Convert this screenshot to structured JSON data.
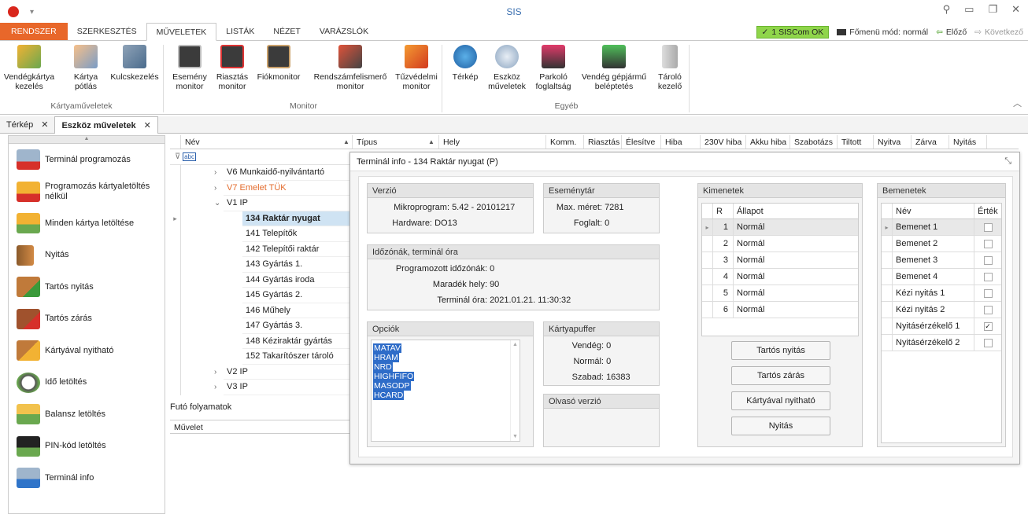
{
  "window": {
    "title": "SIS"
  },
  "ribbon_tabs": [
    "RENDSZER",
    "SZERKESZTÉS",
    "MŰVELETEK",
    "LISTÁK",
    "NÉZET",
    "VARÁZSLÓK"
  ],
  "ribbon_right": {
    "siscom": "1 SISCom OK",
    "mode": "Főmenü mód: normál",
    "prev": "Előző",
    "next": "Következő"
  },
  "groups": {
    "kartya": {
      "label": "Kártyaműveletek",
      "b1": "Vendégkártya\nkezelés",
      "b2": "Kártya\npótlás",
      "b3": "Kulcskezelés"
    },
    "monitor": {
      "label": "Monitor",
      "b1": "Esemény\nmonitor",
      "b2": "Riasztás\nmonitor",
      "b3": "Fiókmonitor",
      "b4": "Rendszámfelismerő\nmonitor",
      "b5": "Tűzvédelmi\nmonitor"
    },
    "egyeb": {
      "label": "Egyéb",
      "b1": "Térkép",
      "b2": "Eszköz\nműveletek",
      "b3": "Parkoló\nfoglaltság",
      "b4": "Vendég gépjármű\nbeléptetés",
      "b5": "Tároló\nkezelő"
    }
  },
  "doc_tabs": {
    "t1": "Térkép",
    "t2": "Eszköz műveletek"
  },
  "sidebar": [
    "Terminál programozás",
    "Programozás kártyaletöltés nélkül",
    "Minden kártya letöltése",
    "Nyitás",
    "Tartós nyitás",
    "Tartós zárás",
    "Kártyával nyitható",
    "Idő letöltés",
    "Balansz letöltés",
    "PIN-kód letöltés",
    "Terminál info"
  ],
  "grid_columns": [
    "Név",
    "Típus",
    "Hely",
    "Komm.",
    "Riasztás",
    "Élesítve",
    "Hiba",
    "230V hiba",
    "Akku hiba",
    "Szabotázs",
    "Tiltott",
    "Nyitva",
    "Zárva",
    "Nyitás"
  ],
  "filter_text": "abc",
  "tree": [
    {
      "text": "V6 Munkaidő-nyilvántartó",
      "indent": 1,
      "exp": ">"
    },
    {
      "text": "V7 Emelet TÜK",
      "indent": 1,
      "exp": ">",
      "orange": true
    },
    {
      "text": "V1 IP",
      "indent": 1,
      "exp": "v"
    },
    {
      "text": "134 Raktár nyugat",
      "indent": 2,
      "sel": true
    },
    {
      "text": "141 Telepítők",
      "indent": 2
    },
    {
      "text": "142 Telepítői raktár",
      "indent": 2
    },
    {
      "text": "143 Gyártás 1.",
      "indent": 2
    },
    {
      "text": "144 Gyártás iroda",
      "indent": 2
    },
    {
      "text": "145 Gyártás 2.",
      "indent": 2
    },
    {
      "text": "146 Műhely",
      "indent": 2
    },
    {
      "text": "147 Gyártás 3.",
      "indent": 2
    },
    {
      "text": "148 Kéziraktár gyártás",
      "indent": 2
    },
    {
      "text": "152 Takarítószer tároló",
      "indent": 2
    },
    {
      "text": "V2 IP",
      "indent": 1,
      "exp": ">"
    },
    {
      "text": "V3 IP",
      "indent": 1,
      "exp": ">"
    }
  ],
  "futo": {
    "title": "Futó folyamatok",
    "col": "Művelet"
  },
  "dialog": {
    "title": "Terminál info - 134 Raktár nyugat (P)",
    "verzio": {
      "h": "Verzió",
      "k1": "Mikroprogram:",
      "v1": "5.42 - 20101217",
      "k2": "Hardware:",
      "v2": "DO13"
    },
    "esemeny": {
      "h": "Eseménytár",
      "k1": "Max. méret:",
      "v1": "7281",
      "k2": "Foglalt:",
      "v2": "0"
    },
    "idozona": {
      "h": "Időzónák, terminál óra",
      "k1": "Programozott időzónák:",
      "v1": "0",
      "k2": "Maradék hely:",
      "v2": "90",
      "k3": "Terminál óra:",
      "v3": "2021.01.21. 11:30:32"
    },
    "opciok": {
      "h": "Opciók",
      "items": [
        "MATAV",
        "HRAM",
        "NRD",
        "HIGHFIFO",
        "MASODP",
        "HCARD"
      ]
    },
    "kartyapuffer": {
      "h": "Kártyapuffer",
      "k1": "Vendég:",
      "v1": "0",
      "k2": "Normál:",
      "v2": "0",
      "k3": "Szabad:",
      "v3": "16383"
    },
    "olvaso": {
      "h": "Olvasó verzió"
    },
    "kimenetek": {
      "h": "Kimenetek",
      "col_r": "R",
      "col_a": "Állapot",
      "rows": [
        [
          "1",
          "Normál"
        ],
        [
          "2",
          "Normál"
        ],
        [
          "3",
          "Normál"
        ],
        [
          "4",
          "Normál"
        ],
        [
          "5",
          "Normál"
        ],
        [
          "6",
          "Normál"
        ]
      ]
    },
    "buttons": {
      "b1": "Tartós nyitás",
      "b2": "Tartós zárás",
      "b3": "Kártyával nyitható",
      "b4": "Nyitás"
    },
    "bemenetek": {
      "h": "Bemenetek",
      "col_n": "Név",
      "col_e": "Érték",
      "rows": [
        {
          "n": "Bemenet 1",
          "v": false
        },
        {
          "n": "Bemenet 2",
          "v": false
        },
        {
          "n": "Bemenet 3",
          "v": false
        },
        {
          "n": "Bemenet 4",
          "v": false
        },
        {
          "n": "Kézi nyitás 1",
          "v": false
        },
        {
          "n": "Kézi nyitás 2",
          "v": false
        },
        {
          "n": "Nyitásérzékelő 1",
          "v": true
        },
        {
          "n": "Nyitásérzékelő 2",
          "v": false
        }
      ]
    }
  }
}
